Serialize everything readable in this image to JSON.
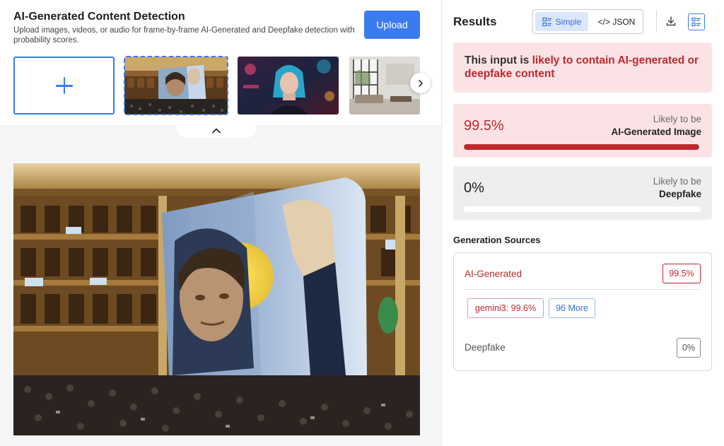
{
  "header": {
    "title": "AI-Generated Content Detection",
    "subtitle": "Upload images, videos, or audio for frame-by-frame AI-Generated and Deepfake detection with probability scores.",
    "upload_label": "Upload"
  },
  "gallery": {
    "add_icon": "plus-icon",
    "next_icon": "chevron-right-icon",
    "collapse_icon": "chevron-up-icon",
    "selected_index": 0
  },
  "results": {
    "title": "Results",
    "view_toggle": {
      "simple_label": "Simple",
      "json_label": "</> JSON",
      "active": "Simple"
    },
    "verdict": {
      "prefix": "This input is ",
      "highlight": "likely to contain AI-generated or deepfake content"
    },
    "scores": [
      {
        "value": "99.5%",
        "fraction": 0.995,
        "label_top": "Likely to be",
        "label_bottom": "AI-Generated Image"
      },
      {
        "value": "0%",
        "fraction": 0,
        "label_top": "Likely to be",
        "label_bottom": "Deepfake"
      }
    ],
    "generation_sources": {
      "title": "Generation Sources",
      "ai_label": "AI-Generated",
      "ai_value": "99.5%",
      "sources": [
        "gemini3: 99.6%"
      ],
      "more_label": "96 More",
      "deepfake_label": "Deepfake",
      "deepfake_value": "0%"
    }
  },
  "colors": {
    "accent": "#3b7bf0",
    "danger": "#c0282d",
    "danger_bg": "#fbe3e5",
    "neutral_bg": "#eeeeee"
  }
}
